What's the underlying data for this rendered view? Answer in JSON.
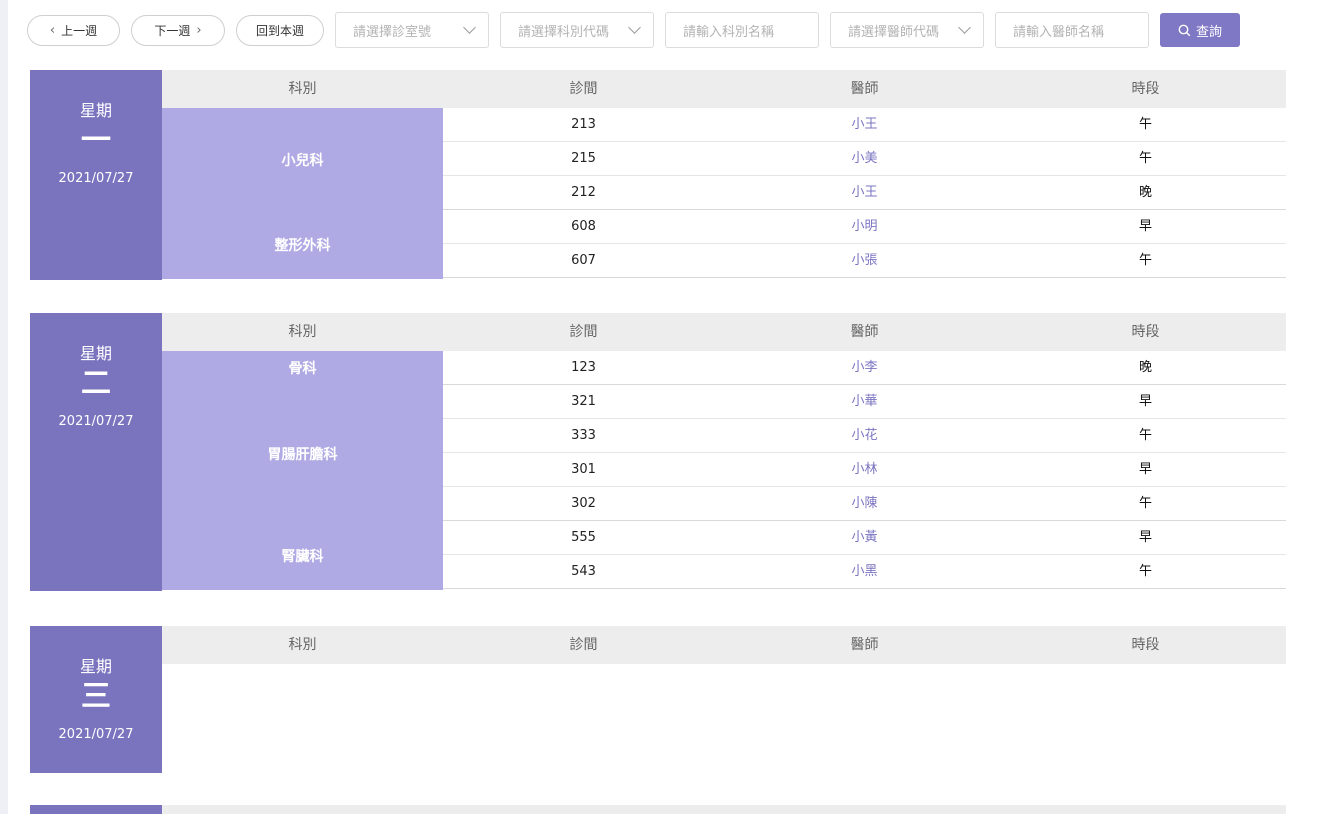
{
  "toolbar": {
    "prev_week": "上一週",
    "next_week": "下一週",
    "this_week": "回到本週",
    "room_select_placeholder": "請選擇診室號",
    "dept_code_select_placeholder": "請選擇科別代碼",
    "dept_name_input_placeholder": "請輸入科別名稱",
    "doctor_code_select_placeholder": "請選擇醫師代碼",
    "doctor_name_input_placeholder": "請輸入醫師名稱",
    "search_label": "查詢"
  },
  "columns": [
    "科別",
    "診間",
    "醫師",
    "時段"
  ],
  "days": [
    {
      "week_label": "星期",
      "day_num": "一",
      "date": "2021/07/27",
      "groups": [
        {
          "dept": "小兒科",
          "rows": [
            {
              "room": "213",
              "doctor": "小王",
              "slot": "午"
            },
            {
              "room": "215",
              "doctor": "小美",
              "slot": "午"
            },
            {
              "room": "212",
              "doctor": "小王",
              "slot": "晚"
            }
          ]
        },
        {
          "dept": "整形外科",
          "rows": [
            {
              "room": "608",
              "doctor": "小明",
              "slot": "早"
            },
            {
              "room": "607",
              "doctor": "小張",
              "slot": "午"
            }
          ]
        }
      ]
    },
    {
      "week_label": "星期",
      "day_num": "二",
      "date": "2021/07/27",
      "groups": [
        {
          "dept": "骨科",
          "rows": [
            {
              "room": "123",
              "doctor": "小李",
              "slot": "晚"
            }
          ]
        },
        {
          "dept": "胃腸肝膽科",
          "rows": [
            {
              "room": "321",
              "doctor": "小華",
              "slot": "早"
            },
            {
              "room": "333",
              "doctor": "小花",
              "slot": "午"
            },
            {
              "room": "301",
              "doctor": "小林",
              "slot": "早"
            },
            {
              "room": "302",
              "doctor": "小陳",
              "slot": "午"
            }
          ]
        },
        {
          "dept": "腎臟科",
          "rows": [
            {
              "room": "555",
              "doctor": "小黃",
              "slot": "早"
            },
            {
              "room": "543",
              "doctor": "小黑",
              "slot": "午"
            }
          ]
        }
      ]
    },
    {
      "week_label": "星期",
      "day_num": "三",
      "date": "2021/07/27",
      "groups": []
    }
  ]
}
